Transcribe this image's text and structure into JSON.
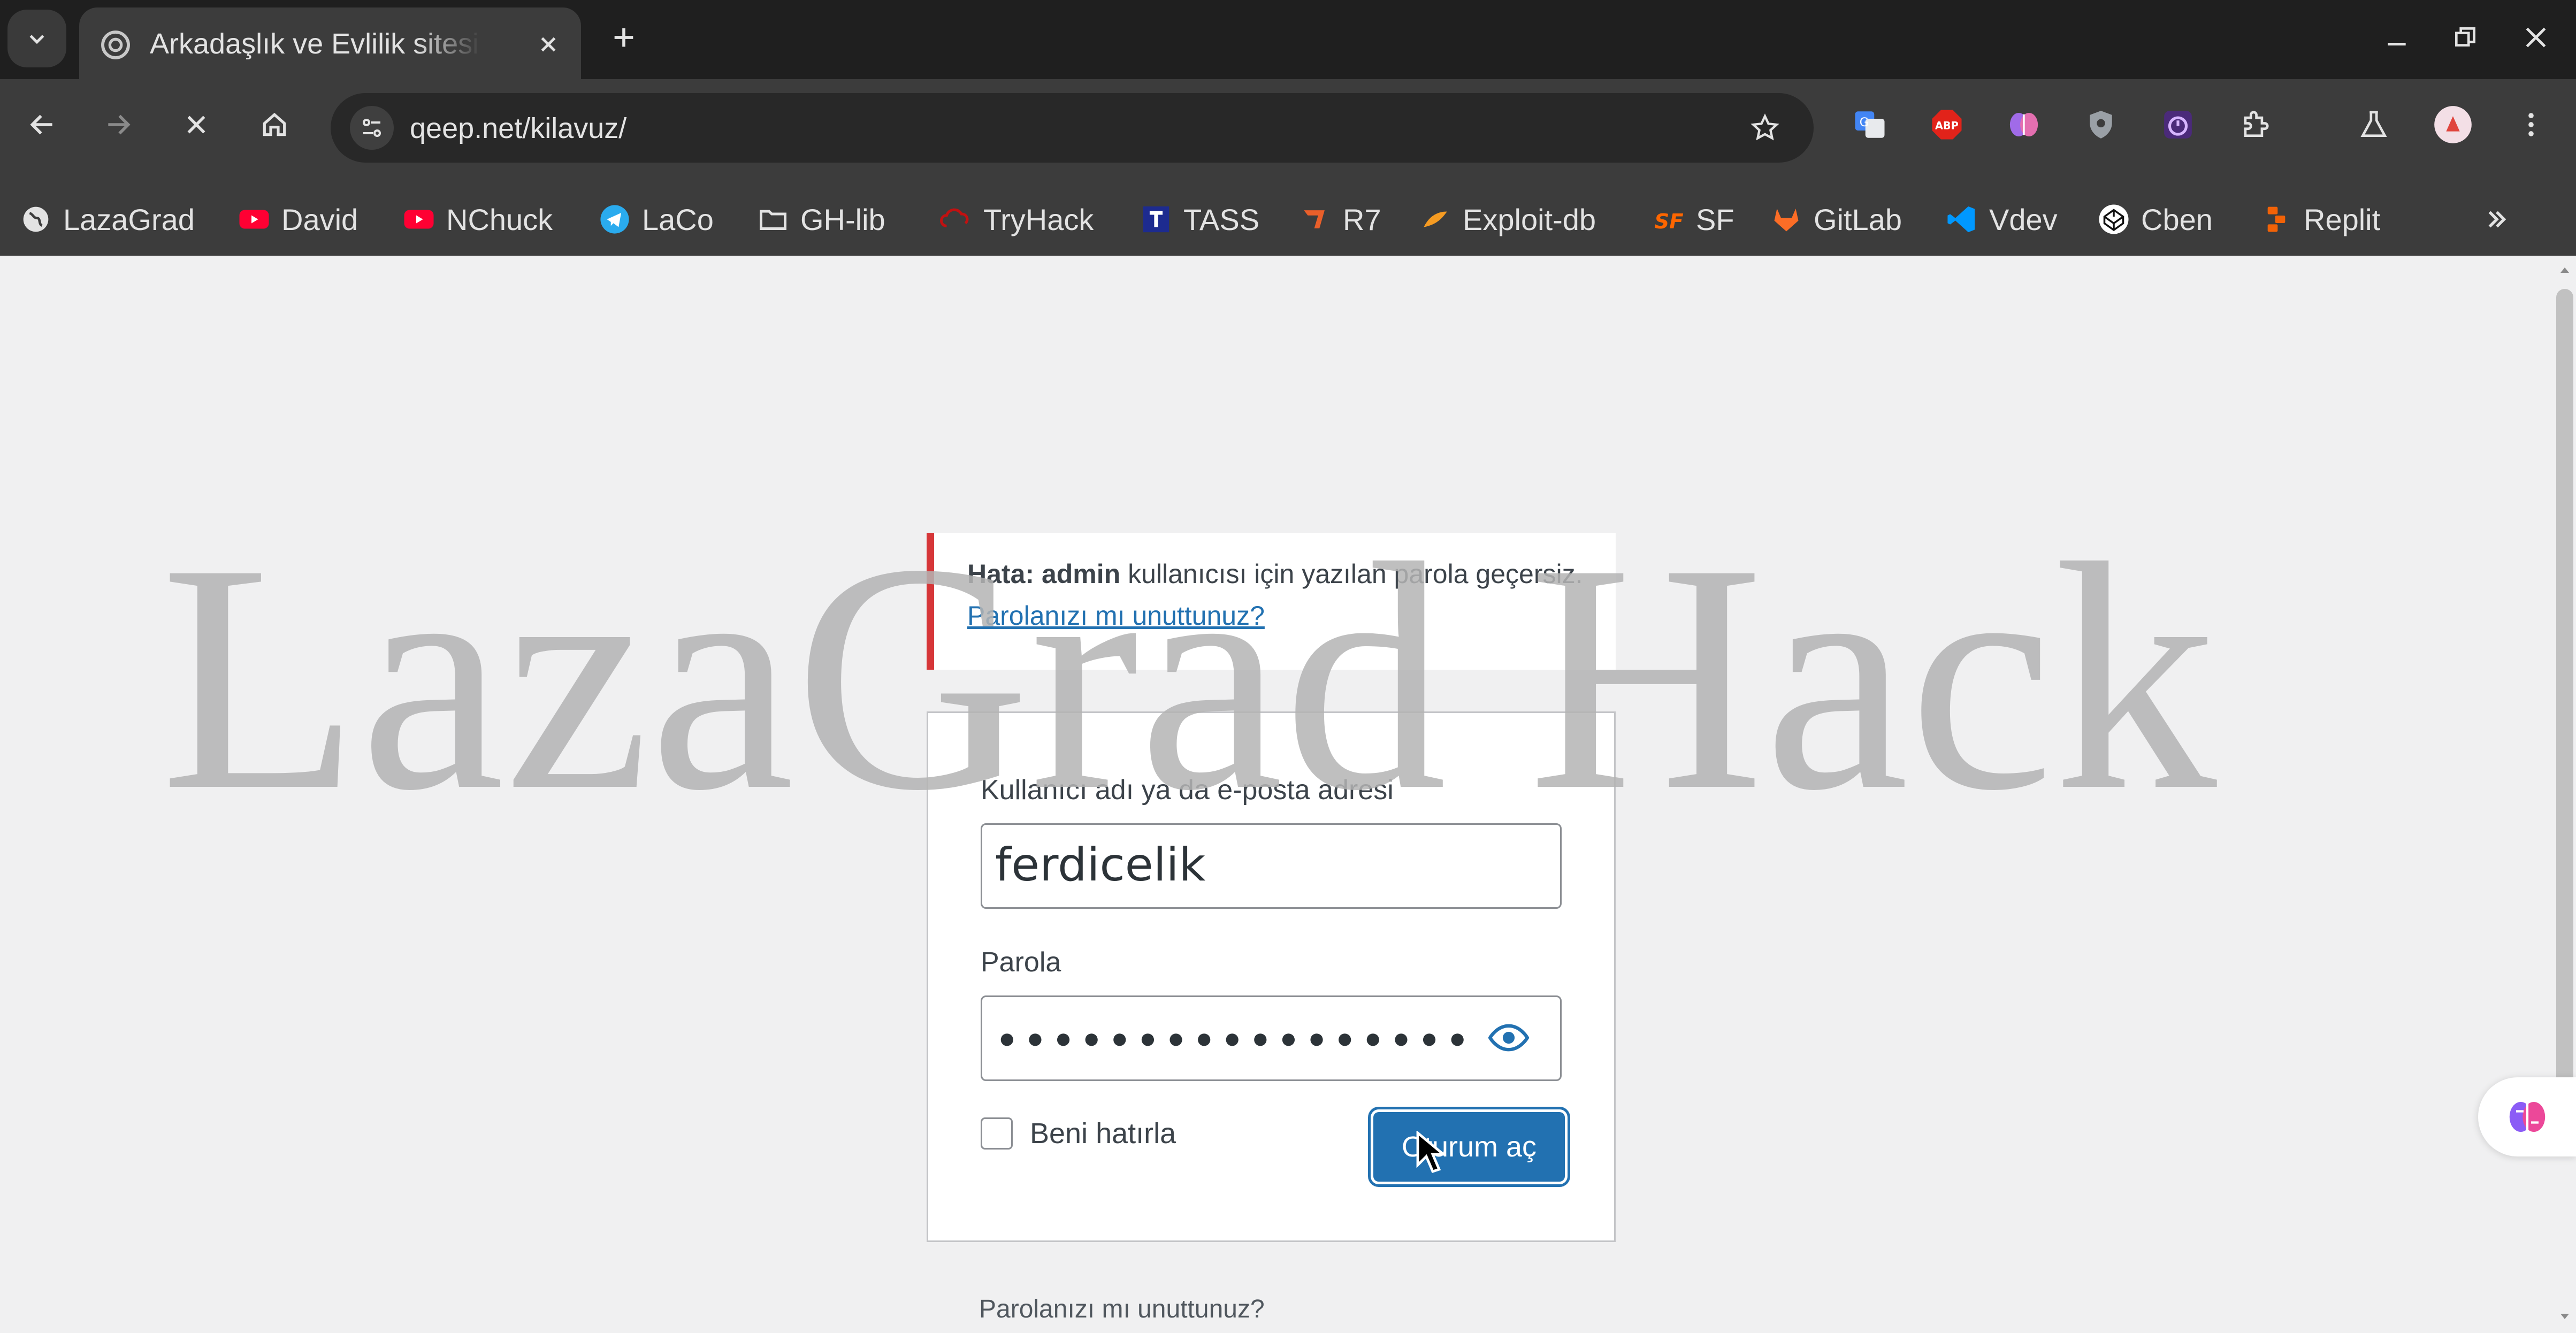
{
  "tab": {
    "title": "Arkadaşlık ve Evlilik sitesi",
    "favicon": "site-icon"
  },
  "toolbar": {
    "url": "qeep.net/kilavuz/"
  },
  "bookmarks": [
    {
      "label": "LazaGrad",
      "icon": "globe-icon"
    },
    {
      "label": "David",
      "icon": "youtube-icon"
    },
    {
      "label": "NChuck",
      "icon": "youtube-icon"
    },
    {
      "label": "LaCo",
      "icon": "telegram-icon"
    },
    {
      "label": "GH-lib",
      "icon": "folder-icon"
    },
    {
      "label": "TryHack",
      "icon": "tryhackme-icon"
    },
    {
      "label": "TASS",
      "icon": "tass-icon"
    },
    {
      "label": "R7",
      "icon": "rapid7-icon"
    },
    {
      "label": "Exploit-db",
      "icon": "exploitdb-icon"
    },
    {
      "label": "SF",
      "icon": "sourceforge-icon"
    },
    {
      "label": "GitLab",
      "icon": "gitlab-icon"
    },
    {
      "label": "Vdev",
      "icon": "vscode-icon"
    },
    {
      "label": "Cben",
      "icon": "codepen-icon"
    },
    {
      "label": "Replit",
      "icon": "replit-icon"
    }
  ],
  "error": {
    "prefix": "Hata:",
    "user": "admin",
    "message": "kullanıcısı için yazılan parola geçersiz.",
    "link": "Parolanızı mı unuttunuz?"
  },
  "form": {
    "username_label": "Kullanıcı adı ya da e-posta adresi",
    "username_value": "ferdicelik",
    "password_label": "Parola",
    "password_masked": "●●●●●●●●●●●●●●●●●",
    "remember_label": "Beni hatırla",
    "remember_checked": false,
    "submit_label": "Oturum aç"
  },
  "lost_password": "Parolanızı mı unuttunuz?",
  "watermark": "LazaGrad Hack",
  "colors": {
    "error_border": "#d63638",
    "primary": "#2271b1",
    "link": "#2271b1"
  }
}
